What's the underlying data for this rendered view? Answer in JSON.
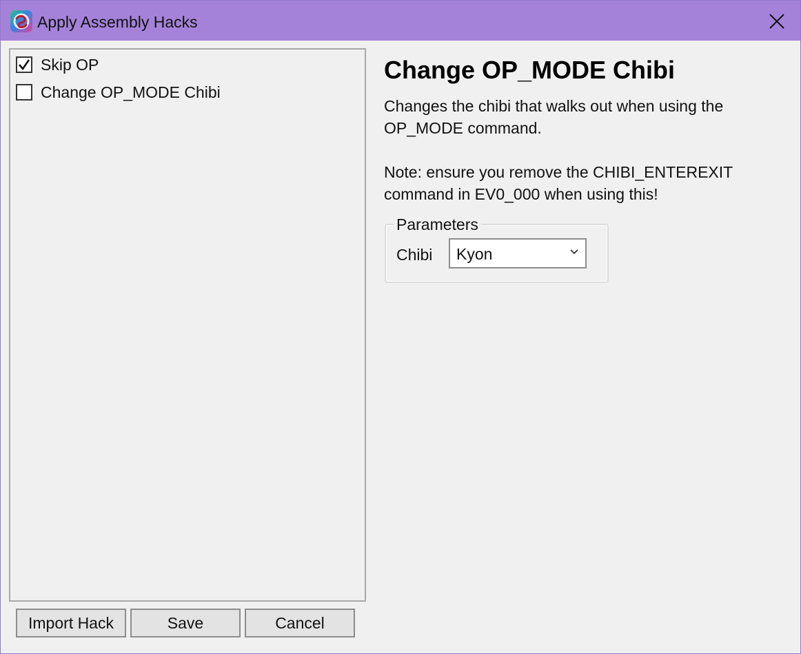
{
  "window": {
    "title": "Apply Assembly Hacks",
    "icon": "app-logo-icon",
    "close_icon": "close-icon",
    "accent_color": "#a582da"
  },
  "hacks": [
    {
      "label": "Skip OP",
      "checked": true
    },
    {
      "label": "Change OP_MODE Chibi",
      "checked": false
    }
  ],
  "detail": {
    "title": "Change OP_MODE Chibi",
    "description": "Changes the chibi that walks out when using the\nOP_MODE command.\n\nNote: ensure you remove the CHIBI_ENTEREXIT\ncommand in EV0_000 when using this!"
  },
  "parameters": {
    "legend": "Parameters",
    "chibi_label": "Chibi",
    "chibi_value": "Kyon"
  },
  "buttons": {
    "import": "Import Hack",
    "save": "Save",
    "cancel": "Cancel"
  }
}
